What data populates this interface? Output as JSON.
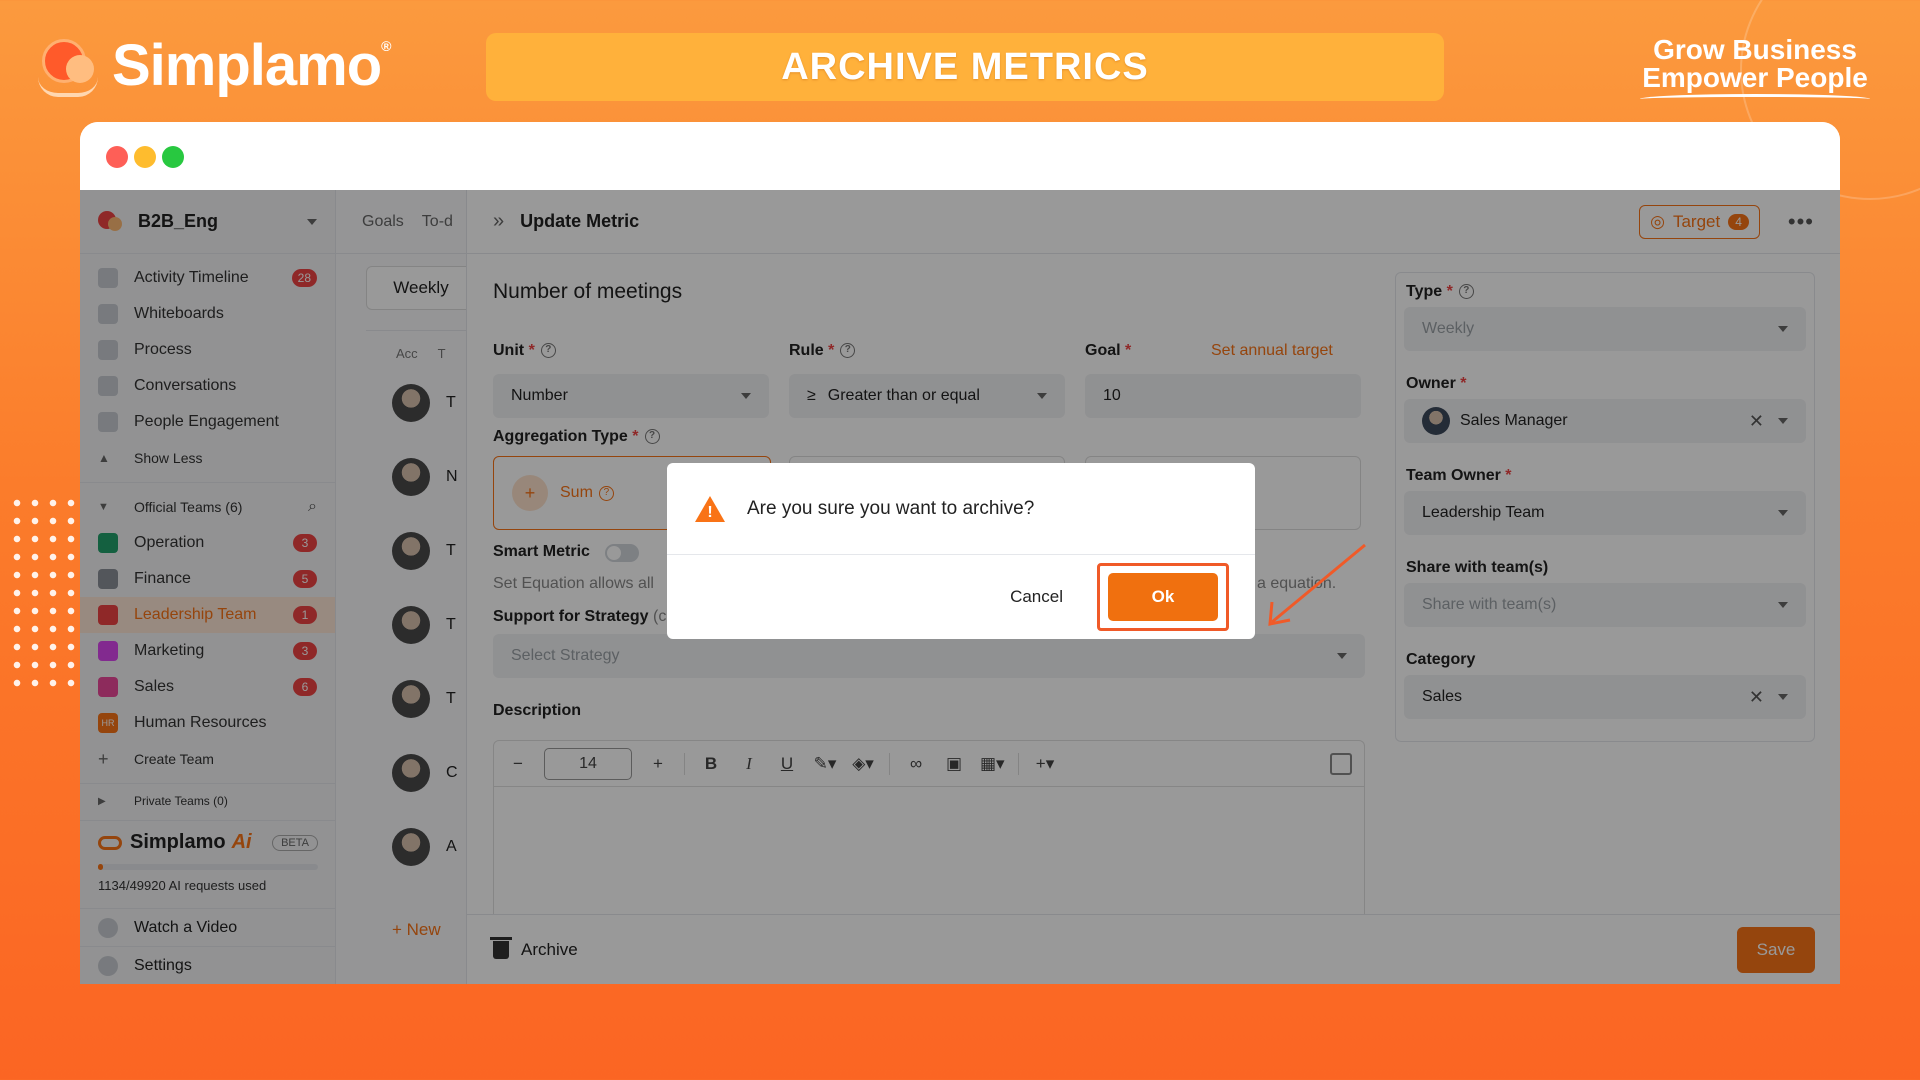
{
  "banner": {
    "brand": "Simplamo",
    "title": "ARCHIVE METRICS",
    "tagline_line1": "Grow Business",
    "tagline_line2": "Empower People"
  },
  "sidebar": {
    "workspace": "B2B_Eng",
    "items": [
      {
        "label": "Activity Timeline",
        "badge": "28"
      },
      {
        "label": "Whiteboards"
      },
      {
        "label": "Process"
      },
      {
        "label": "Conversations"
      },
      {
        "label": "People Engagement"
      }
    ],
    "show_less": "Show Less",
    "official_teams": "Official Teams (6)",
    "teams": [
      {
        "label": "Operation",
        "badge": "3",
        "color": "#22a06b"
      },
      {
        "label": "Finance",
        "badge": "5",
        "color": "#8b8f98"
      },
      {
        "label": "Leadership Team",
        "badge": "1",
        "color": "#ef4444"
      },
      {
        "label": "Marketing",
        "badge": "3",
        "color": "#d946ef"
      },
      {
        "label": "Sales",
        "badge": "6",
        "color": "#ec4899"
      },
      {
        "label": "Human Resources",
        "icon_text": "HR",
        "color": "#f97316"
      }
    ],
    "create_team": "Create Team",
    "private_teams": "Private Teams (0)",
    "ai": {
      "brand": "Simplamo",
      "suffix": "Ai",
      "beta": "BETA",
      "used": "1134/49920 AI requests used",
      "used_fraction": 0.023
    },
    "watch_video": "Watch a Video",
    "settings": "Settings"
  },
  "listpanel": {
    "tabs": [
      "Goals",
      "To-d"
    ],
    "weekly": "Weekly",
    "col_acc": "Acc",
    "col_t": "T",
    "rows": [
      "T",
      "N",
      "T",
      "T",
      "T",
      "C",
      "A"
    ],
    "new": "+ New"
  },
  "panel": {
    "title": "Update Metric",
    "target_label": "Target",
    "target_count": "4",
    "metric_name": "Number of meetings",
    "unit_label": "Unit",
    "unit_value": "Number",
    "rule_label": "Rule",
    "rule_symbol": "≥",
    "rule_value": "Greater than or equal",
    "goal_label": "Goal",
    "goal_value": "10",
    "annual_link": "Set annual target",
    "aggregation_label": "Aggregation Type",
    "aggregation_value": "Sum",
    "smart_metric": "Smart Metric",
    "smart_desc_left": "Set Equation allows all",
    "smart_desc_right": "a equation.",
    "strategy_label": "Support for Strategy",
    "strategy_label_cut": "(c",
    "strategy_placeholder": "Select Strategy",
    "description_label": "Description",
    "font_size": "14",
    "archive": "Archive",
    "save": "Save",
    "type_label": "Type",
    "type_value": "Weekly",
    "owner_label": "Owner",
    "owner_value": "Sales Manager",
    "team_owner_label": "Team Owner",
    "team_owner_value": "Leadership Team",
    "share_label": "Share with team(s)",
    "share_placeholder": "Share with team(s)",
    "category_label": "Category",
    "category_value": "Sales"
  },
  "dialog": {
    "message": "Are you sure you want to archive?",
    "cancel": "Cancel",
    "ok": "Ok"
  },
  "colors": {
    "accent": "#f97316",
    "danger": "#ef4444"
  }
}
